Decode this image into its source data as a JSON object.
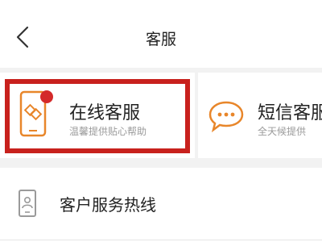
{
  "header": {
    "title": "客服",
    "back_icon": "back-arrow-icon"
  },
  "cards": [
    {
      "title": "在线客服",
      "subtitle": "温馨提供贴心帮助",
      "icon": "phone-chat-icon",
      "badge": "red-dot",
      "selected": true
    },
    {
      "title": "短信客服",
      "subtitle": "全天候提供",
      "icon": "sms-bubble-icon"
    }
  ],
  "hotline": {
    "label": "客户服务热线",
    "icon": "phone-outline-icon"
  },
  "colors": {
    "accent": "#e8862a",
    "highlight": "#c8211d",
    "background": "#f2f2f2"
  }
}
